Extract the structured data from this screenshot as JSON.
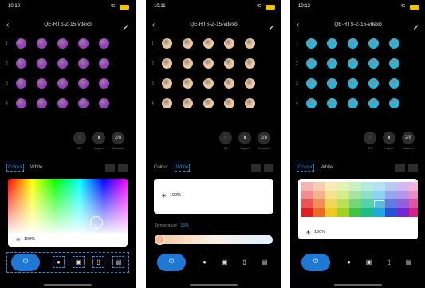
{
  "screens": [
    {
      "status": {
        "time": "10:10",
        "signal": "4G"
      },
      "header": {
        "title": "QE-RTS-Z-15-vdexb"
      },
      "rows": [
        "1",
        "2",
        "3",
        "4"
      ],
      "tools": [
        {
          "label": "C1"
        },
        {
          "label": "Import"
        },
        {
          "label": "Number",
          "value": "2/8"
        }
      ],
      "tabs": {
        "colour": "Colour",
        "white": "White",
        "active": "colour"
      },
      "brightness": {
        "value": "100%"
      },
      "dot_color": "#9b3fc0",
      "selected_hue": "#e6e0ea"
    },
    {
      "status": {
        "time": "10:11",
        "signal": "4G"
      },
      "header": {
        "title": "QE-RTS-Z-15-vdexb"
      },
      "rows": [
        "1",
        "2",
        "3",
        "4"
      ],
      "tools": [
        {
          "label": "C1"
        },
        {
          "label": "Import"
        },
        {
          "label": "Number",
          "value": "2/8"
        }
      ],
      "tabs": {
        "colour": "Colour",
        "white": "White",
        "active": "white"
      },
      "brightness": {
        "value": "100%"
      },
      "temperature": {
        "label": "Temperature - ",
        "value": "15%"
      },
      "dot_color": "#f0c8a0"
    },
    {
      "status": {
        "time": "10:12",
        "signal": "4G"
      },
      "header": {
        "title": "QE-RTS-Z-15-vdexb"
      },
      "rows": [
        "1",
        "2",
        "3",
        "4"
      ],
      "tools": [
        {
          "label": "C1"
        },
        {
          "label": "Import"
        },
        {
          "label": "Number",
          "value": "2/8"
        }
      ],
      "tabs": {
        "colour": "Colour",
        "white": "White",
        "active": "colour"
      },
      "brightness": {
        "value": "100%"
      },
      "dot_color": "#22b8e0",
      "swatches": [
        [
          "#f4b3b3",
          "#f6cdb3",
          "#f8ebb3",
          "#e4f3b3",
          "#c9f0c0",
          "#b3ecdc",
          "#b3e2f4",
          "#b9c8f3",
          "#d0b9f3",
          "#f0b3dc"
        ],
        [
          "#f08c8c",
          "#f4b28c",
          "#f6e38c",
          "#d3ec8c",
          "#a6e5a0",
          "#8ce0c7",
          "#8cd3ef",
          "#94a7ec",
          "#b794ec",
          "#ea8cc6"
        ],
        [
          "#ea5555",
          "#f08e55",
          "#f2d655",
          "#bce055",
          "#74d676",
          "#55d0a9",
          "#55bfe8",
          "#5e7ce2",
          "#945ee2",
          "#e155a6"
        ],
        [
          "#e02020",
          "#ea6c20",
          "#ecc820",
          "#a3d120",
          "#40c446",
          "#20bc88",
          "#20a8e0",
          "#2852d6",
          "#6e28d6",
          "#d62086"
        ]
      ],
      "selected": {
        "row": 2,
        "col": 6
      }
    }
  ]
}
